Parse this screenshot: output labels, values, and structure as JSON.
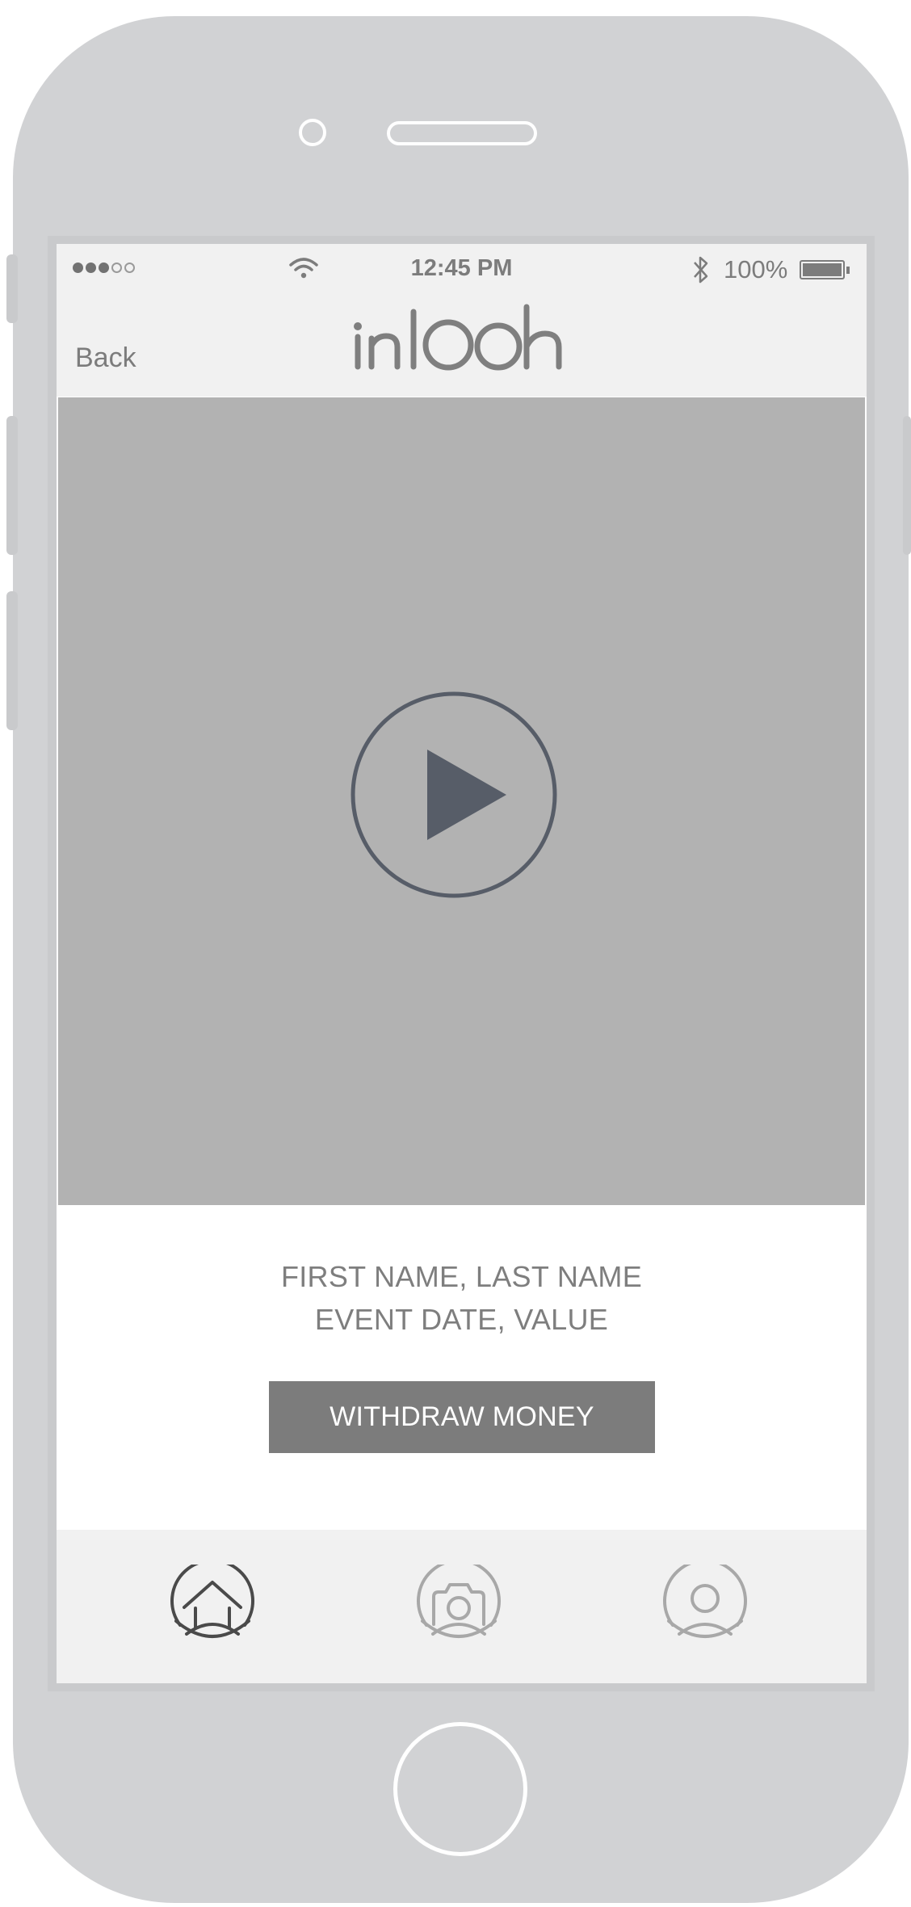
{
  "status_bar": {
    "time": "12:45 PM",
    "battery": "100%",
    "signal_bars": 3,
    "signal_total": 5
  },
  "header": {
    "back_label": "Back",
    "logo_text": "inlooh"
  },
  "video": {
    "play_icon": "play-icon"
  },
  "info": {
    "line1": "FIRST NAME, LAST NAME",
    "line2": "EVENT DATE, VALUE",
    "withdraw_label": "WITHDRAW MONEY"
  },
  "tabbar": {
    "tabs": [
      {
        "icon": "home-eye-icon",
        "active": true
      },
      {
        "icon": "camera-icon",
        "active": false
      },
      {
        "icon": "profile-icon",
        "active": false
      }
    ]
  },
  "colors": {
    "device": "#d1d2d4",
    "header_bg": "#f1f1f1",
    "video_bg": "#b2b2b2",
    "play_icon": "#575d68",
    "button_bg": "#7c7c7c",
    "text_gray": "#7e7e7e",
    "active_icon": "#4a4a4a",
    "inactive_icon": "#a8a8a8"
  }
}
